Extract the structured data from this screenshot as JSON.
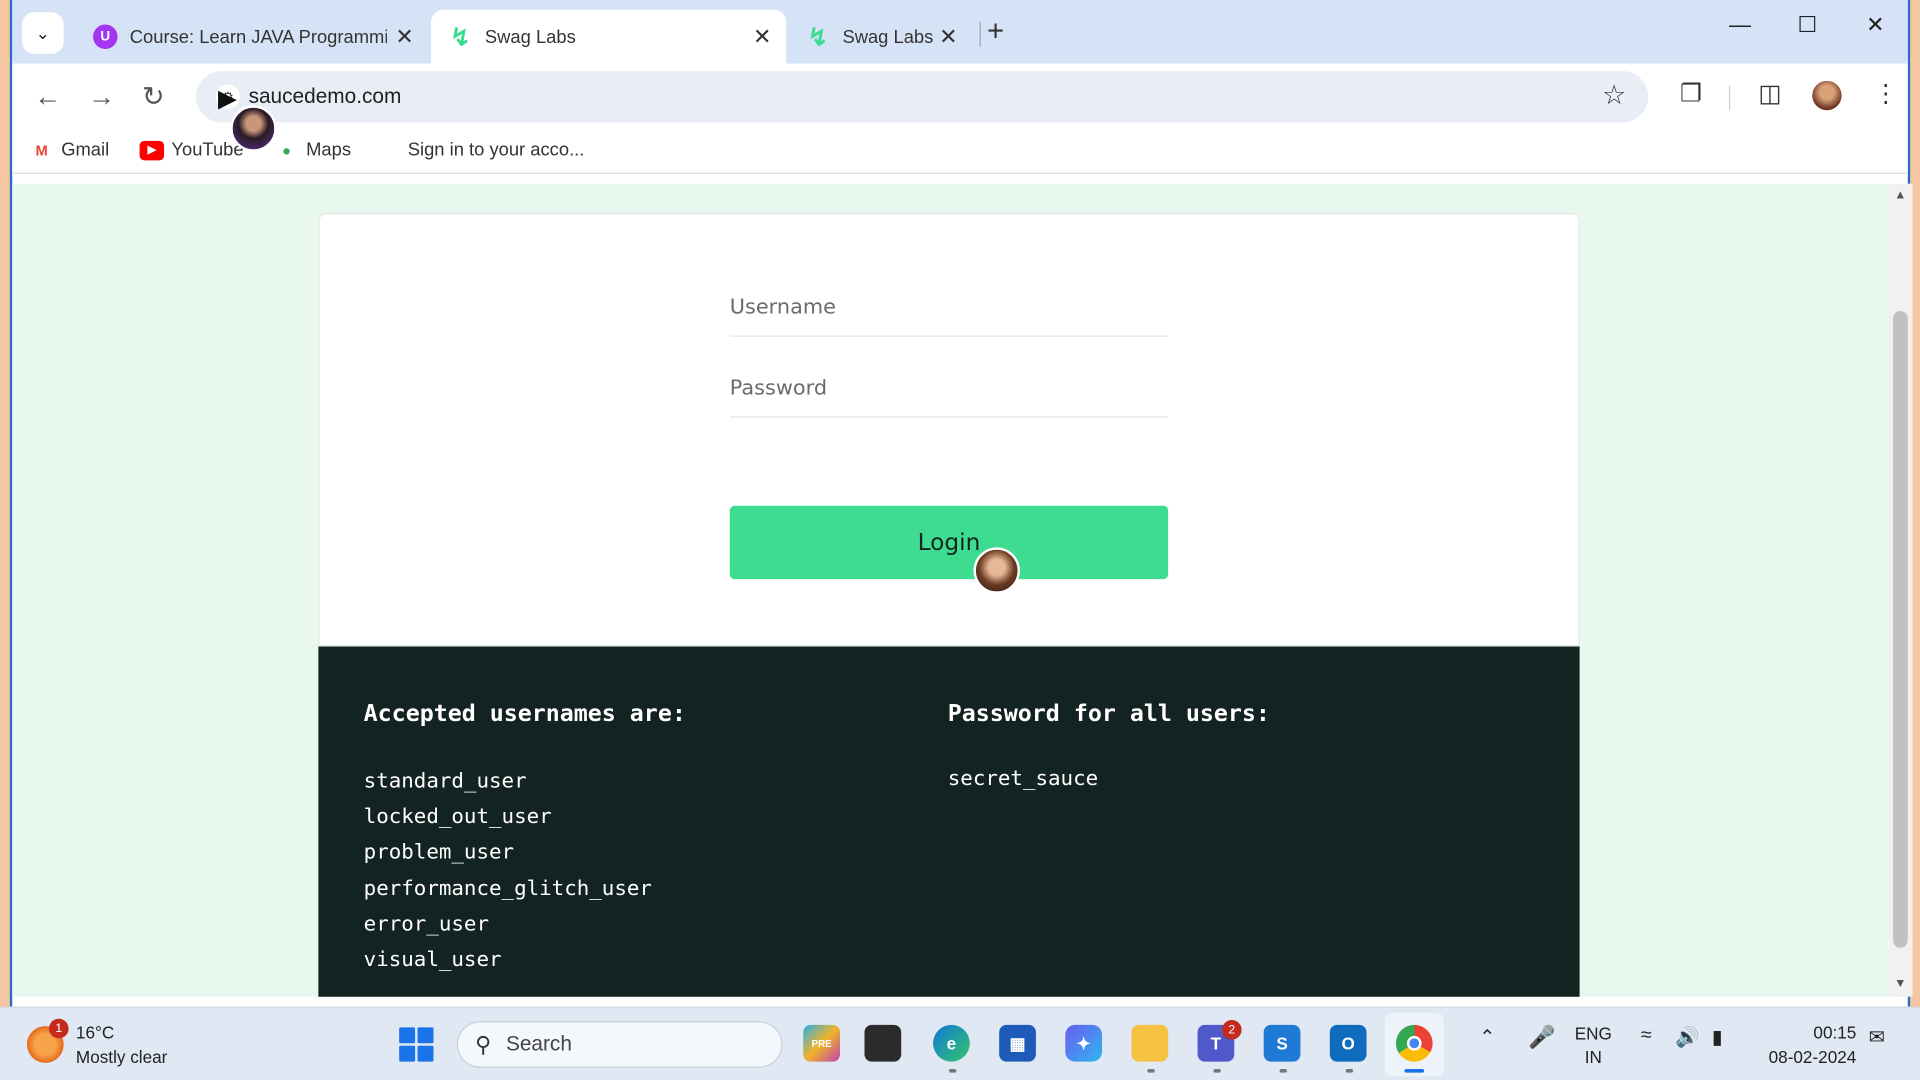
{
  "browser": {
    "tabs": [
      {
        "title": "Course: Learn JAVA Programmin",
        "favicon": "udemy-icon",
        "active": false
      },
      {
        "title": "Swag Labs",
        "favicon": "swag-labs-icon",
        "active": true
      },
      {
        "title": "Swag Labs",
        "favicon": "swag-labs-icon",
        "active": false
      }
    ],
    "url": "saucedemo.com",
    "bookmarks": [
      {
        "label": "Gmail",
        "icon": "gmail-icon"
      },
      {
        "label": "YouTube",
        "icon": "youtube-icon"
      },
      {
        "label": "Maps",
        "icon": "maps-icon"
      },
      {
        "label": "Sign in to your acco...",
        "icon": "microsoft-icon"
      }
    ]
  },
  "login": {
    "username_placeholder": "Username",
    "password_placeholder": "Password",
    "login_label": "Login",
    "accent_color": "#3ddc91"
  },
  "credentials": {
    "usernames_heading": "Accepted usernames are:",
    "usernames": [
      "standard_user",
      "locked_out_user",
      "problem_user",
      "performance_glitch_user",
      "error_user",
      "visual_user"
    ],
    "password_heading": "Password for all users:",
    "password": "secret_sauce"
  },
  "taskbar": {
    "weather_temp": "16°C",
    "weather_desc": "Mostly clear",
    "weather_badge": "1",
    "search_label": "Search",
    "lang_top": "ENG",
    "lang_bottom": "IN",
    "time": "00:15",
    "date": "08-02-2024",
    "teams_badge": "2"
  }
}
